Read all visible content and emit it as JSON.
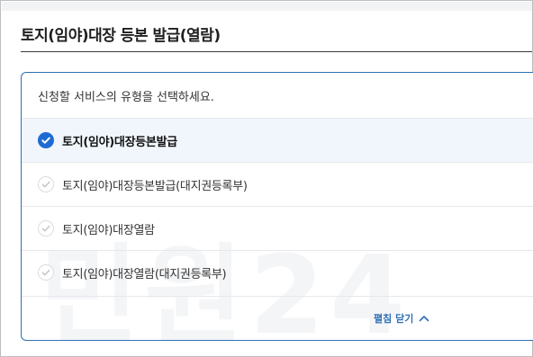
{
  "page": {
    "title": "토지(임야)대장 등본 발급(열람)"
  },
  "panel": {
    "instruction": "신청할 서비스의 유형을 선택하세요.",
    "options": [
      {
        "label": "토지(임야)대장등본발급",
        "selected": true
      },
      {
        "label": "토지(임야)대장등본발급(대지권등록부)",
        "selected": false
      },
      {
        "label": "토지(임야)대장열람",
        "selected": false
      },
      {
        "label": "토지(임야)대장열람(대지권등록부)",
        "selected": false
      }
    ],
    "collapse_label": "펼침 닫기",
    "watermark_text": "민원24"
  },
  "colors": {
    "accent": "#1f6bd3",
    "panel_border": "#2f6fb6",
    "selected_bg": "#f1f6fc"
  },
  "icons": {
    "selected": "check-circle-filled-icon",
    "unselected": "check-circle-outline-icon",
    "collapse": "chevron-up-icon"
  }
}
